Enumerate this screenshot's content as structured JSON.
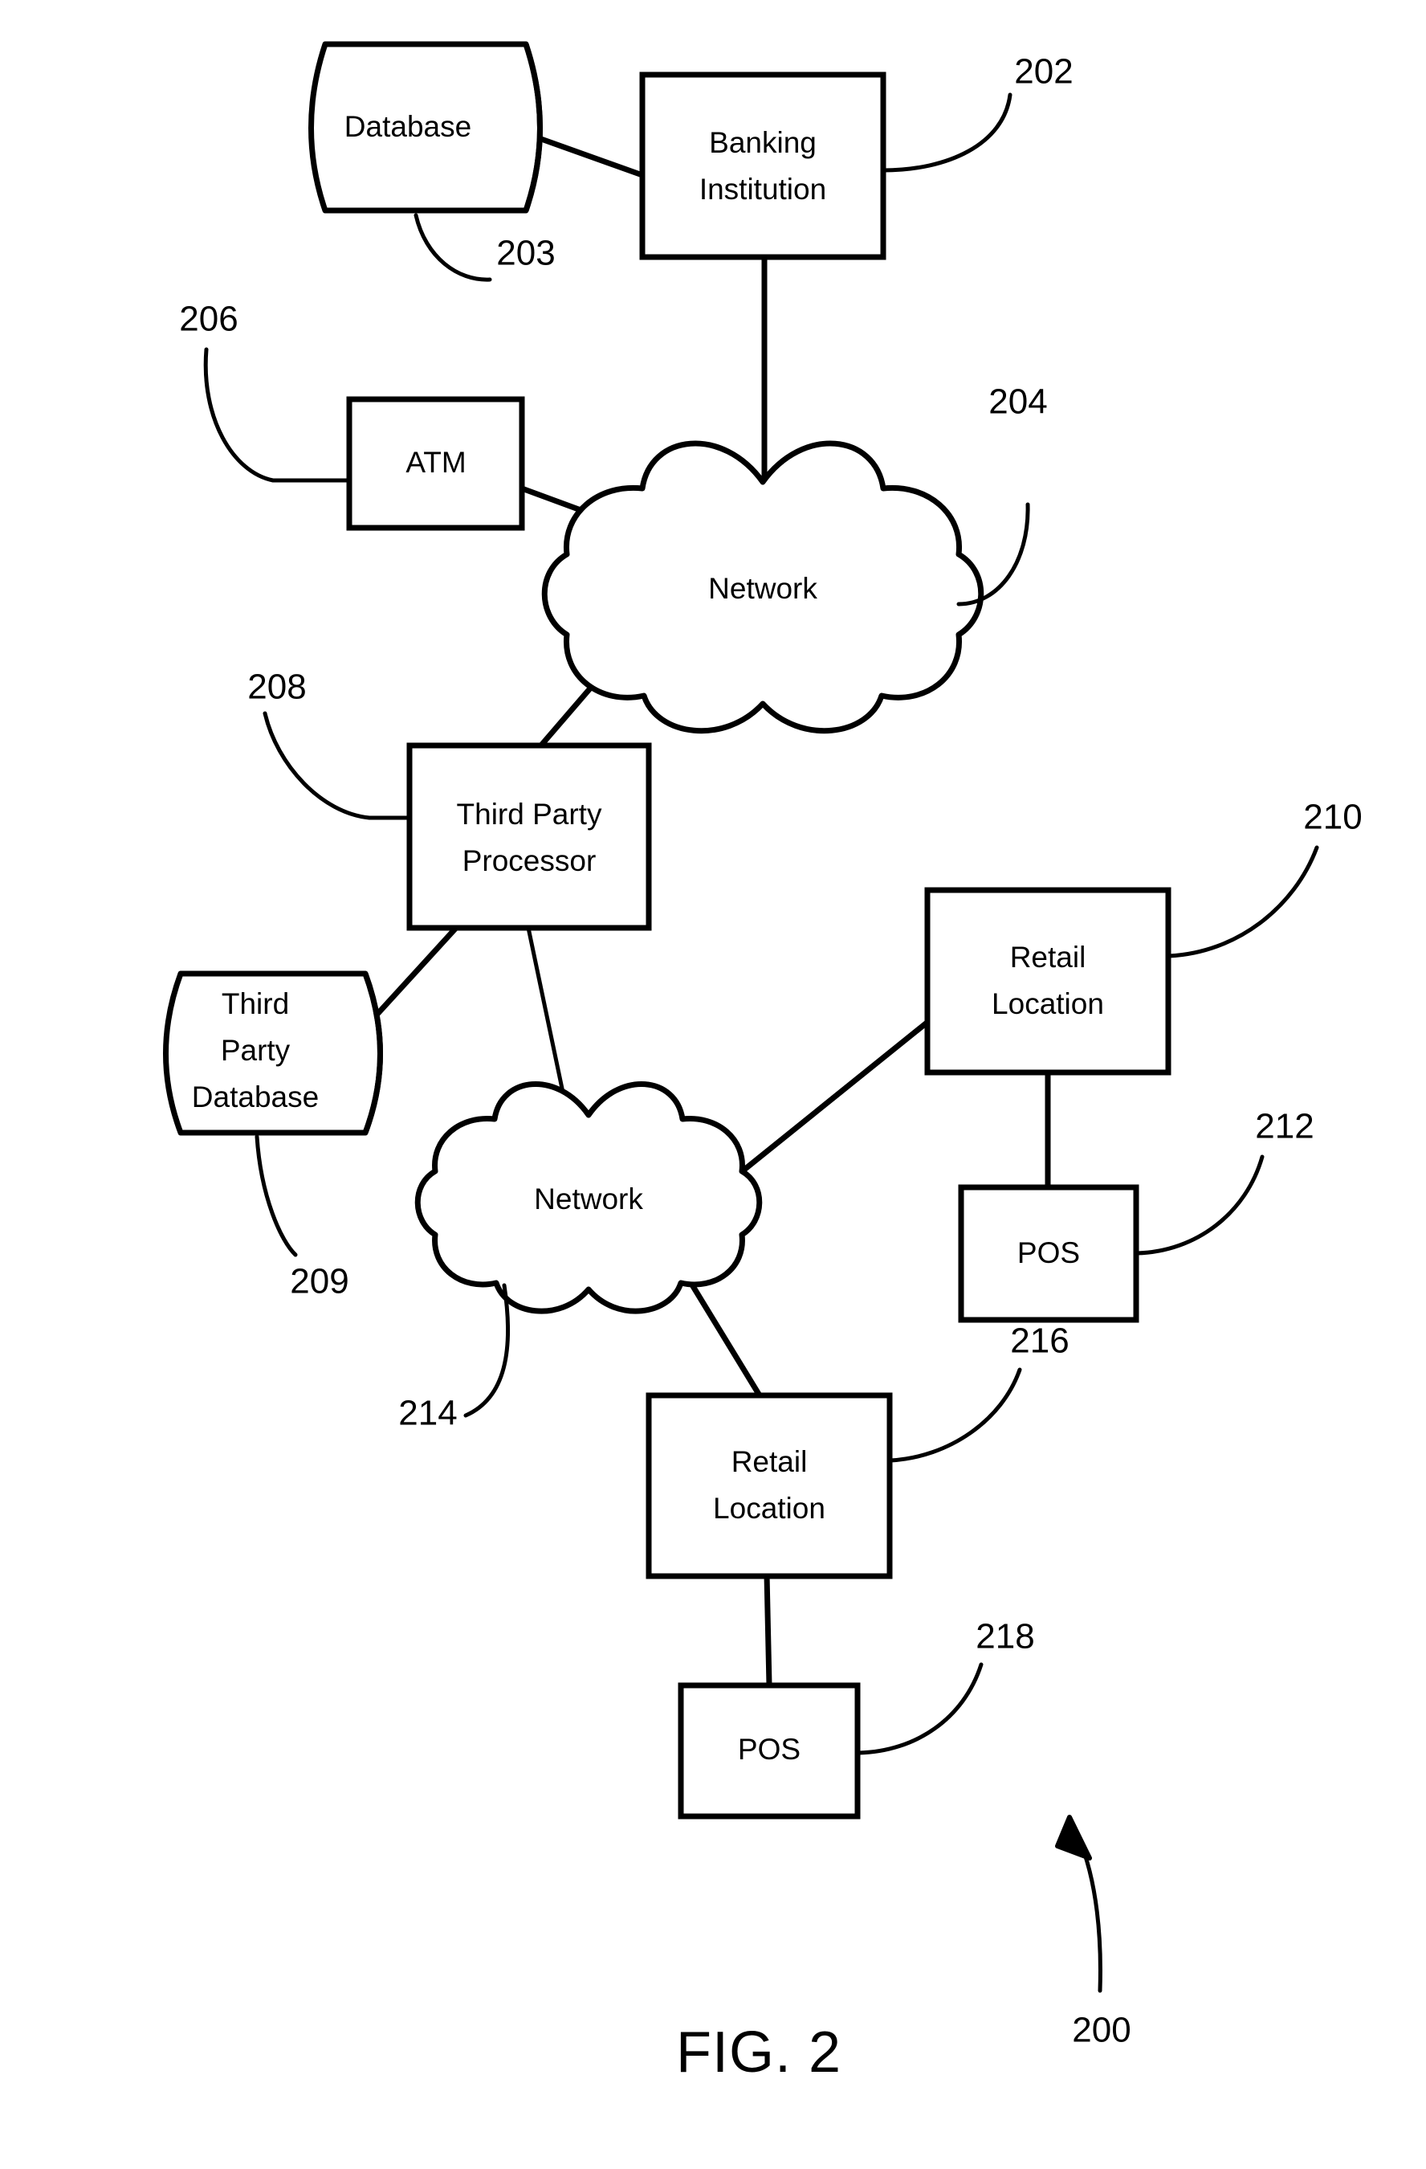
{
  "figure": {
    "caption": "FIG. 2",
    "overall_ref": "200"
  },
  "nodes": [
    {
      "id": "database",
      "type": "cylinder",
      "label": "Database",
      "ref": "203"
    },
    {
      "id": "banking",
      "type": "box",
      "label_line1": "Banking",
      "label_line2": "Institution",
      "ref": "202"
    },
    {
      "id": "network_top",
      "type": "cloud",
      "label": "Network",
      "ref": "204"
    },
    {
      "id": "atm",
      "type": "box",
      "label": "ATM",
      "ref": "206"
    },
    {
      "id": "third_processor",
      "type": "box",
      "label_line1": "Third Party",
      "label_line2": "Processor",
      "ref": "208"
    },
    {
      "id": "third_database",
      "type": "cylinder",
      "label_line1": "Third",
      "label_line2": "Party",
      "label_line3": "Database",
      "ref": "209"
    },
    {
      "id": "network_bottom",
      "type": "cloud",
      "label": "Network",
      "ref": "214"
    },
    {
      "id": "retail_right",
      "type": "box",
      "label_line1": "Retail",
      "label_line2": "Location",
      "ref": "210"
    },
    {
      "id": "pos_right",
      "type": "box",
      "label": "POS",
      "ref": "212"
    },
    {
      "id": "retail_bottom",
      "type": "box",
      "label_line1": "Retail",
      "label_line2": "Location",
      "ref": "216"
    },
    {
      "id": "pos_bottom",
      "type": "box",
      "label": "POS",
      "ref": "218"
    }
  ],
  "labels": {
    "database": "Database",
    "banking_line1": "Banking",
    "banking_line2": "Institution",
    "network_top": "Network",
    "atm": "ATM",
    "processor_line1": "Third Party",
    "processor_line2": "Processor",
    "tpdb_line1": "Third",
    "tpdb_line2": "Party",
    "tpdb_line3": "Database",
    "network_bottom": "Network",
    "retail_right_line1": "Retail",
    "retail_right_line2": "Location",
    "pos_right": "POS",
    "retail_bottom_line1": "Retail",
    "retail_bottom_line2": "Location",
    "pos_bottom": "POS"
  },
  "refs": {
    "r200": "200",
    "r202": "202",
    "r203": "203",
    "r204": "204",
    "r206": "206",
    "r208": "208",
    "r209": "209",
    "r210": "210",
    "r212": "212",
    "r214": "214",
    "r216": "216",
    "r218": "218"
  },
  "connections": [
    {
      "from": "database",
      "to": "banking"
    },
    {
      "from": "banking",
      "to": "network_top"
    },
    {
      "from": "atm",
      "to": "network_top"
    },
    {
      "from": "network_top",
      "to": "third_processor"
    },
    {
      "from": "third_processor",
      "to": "third_database"
    },
    {
      "from": "third_processor",
      "to": "network_bottom"
    },
    {
      "from": "network_bottom",
      "to": "retail_right"
    },
    {
      "from": "retail_right",
      "to": "pos_right"
    },
    {
      "from": "network_bottom",
      "to": "retail_bottom"
    },
    {
      "from": "retail_bottom",
      "to": "pos_bottom"
    }
  ],
  "colors": {
    "stroke": "#000000",
    "fill": "#ffffff",
    "text": "#000000"
  }
}
